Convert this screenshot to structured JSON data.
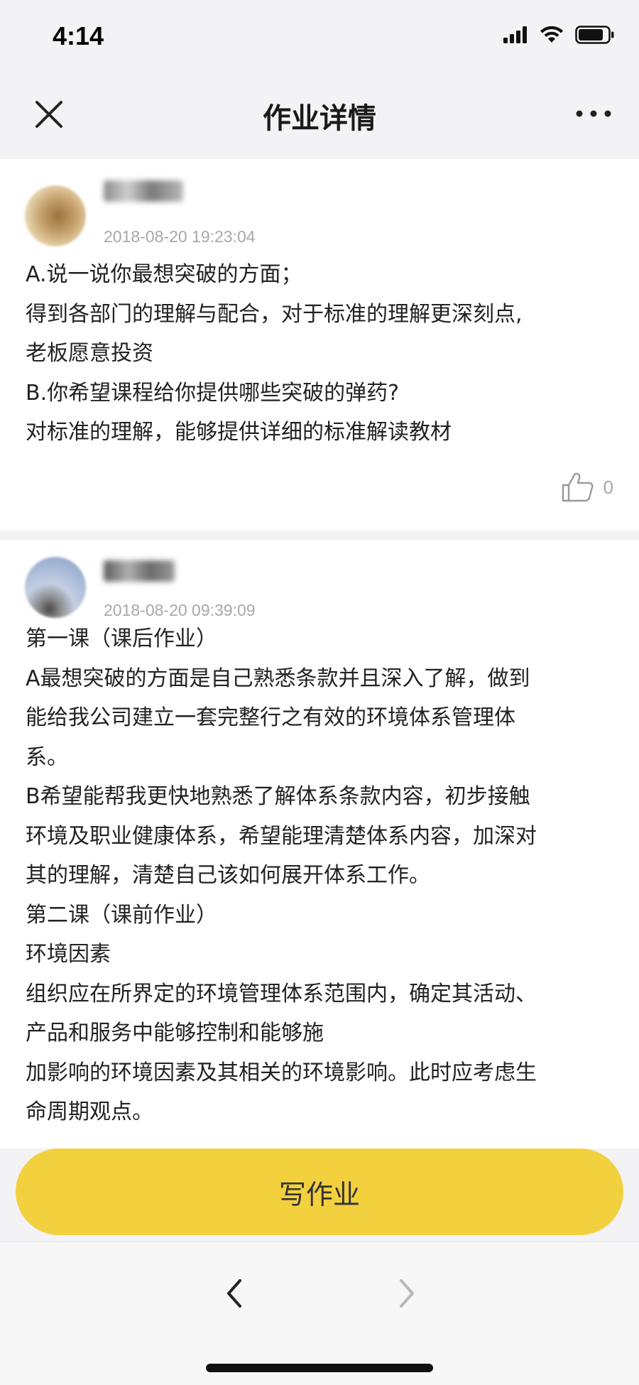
{
  "status_bar": {
    "time": "4:14",
    "icons": [
      "signal-icon",
      "wifi-icon",
      "battery-icon"
    ]
  },
  "header": {
    "title": "作业详情",
    "close_icon": "close-icon",
    "more_icon": "more-icon"
  },
  "posts": [
    {
      "timestamp": "2018-08-20 19:23:04",
      "lines": [
        "A.说一说你最想突破的方面；",
        "得到各部门的理解与配合，对于标准的理解更深刻点,",
        "老板愿意投资",
        "B.你希望课程给你提供哪些突破的弹药?",
        "对标准的理解，能够提供详细的标准解读教材"
      ],
      "likes": "0"
    },
    {
      "timestamp": "2018-08-20 09:39:09",
      "lines": [
        "第一课（课后作业）",
        "A最想突破的方面是自己熟悉条款并且深入了解，做到",
        "能给我公司建立一套完整行之有效的环境体系管理体",
        "系。",
        "B希望能帮我更快地熟悉了解体系条款内容，初步接触",
        "环境及职业健康体系，希望能理清楚体系内容，加深对",
        "其的理解，清楚自己该如何展开体系工作。",
        "第二课（课前作业）",
        "环境因素",
        "组织应在所界定的环境管理体系范围内，确定其活动、",
        "产品和服务中能够控制和能够施",
        "加影响的环境因素及其相关的环境影响。此时应考虑生",
        "命周期观点。"
      ]
    }
  ],
  "actions": {
    "write_label": "写作业"
  },
  "colors": {
    "accent": "#f3d03e",
    "background": "#f3f3f5",
    "muted_text": "#a8a8a8"
  }
}
